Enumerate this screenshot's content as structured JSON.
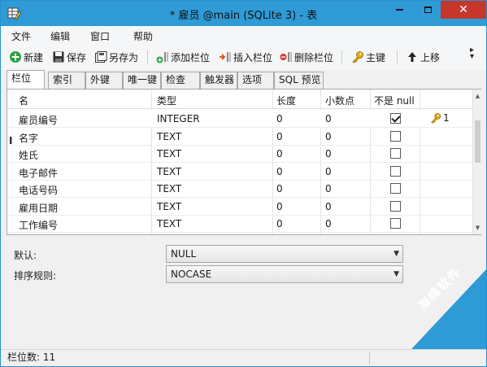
{
  "window": {
    "title": "* 雇员 @main (SQLite 3) - 表"
  },
  "menu": [
    "文件",
    "编辑",
    "窗口",
    "帮助"
  ],
  "toolbar": {
    "new": "新建",
    "save": "保存",
    "save_as": "另存为",
    "add_column": "添加栏位",
    "insert_column": "插入栏位",
    "delete_column": "删除栏位",
    "primary_key": "主键",
    "move_up": "上移"
  },
  "tabs": [
    "栏位",
    "索引",
    "外键",
    "唯一键",
    "检查",
    "触发器",
    "选项",
    "SQL 预览"
  ],
  "grid": {
    "headers": {
      "name": "名",
      "type": "类型",
      "length": "长度",
      "decimals": "小数点",
      "not_null": "不是 null",
      "key": ""
    },
    "rows": [
      {
        "name": "雇员编号",
        "type": "INTEGER",
        "length": "0",
        "decimals": "0",
        "not_null": true,
        "key": "1"
      },
      {
        "name": "名字",
        "type": "TEXT",
        "length": "0",
        "decimals": "0",
        "not_null": false,
        "key": ""
      },
      {
        "name": "姓氏",
        "type": "TEXT",
        "length": "0",
        "decimals": "0",
        "not_null": false,
        "key": ""
      },
      {
        "name": "电子邮件",
        "type": "TEXT",
        "length": "0",
        "decimals": "0",
        "not_null": false,
        "key": ""
      },
      {
        "name": "电话号码",
        "type": "TEXT",
        "length": "0",
        "decimals": "0",
        "not_null": false,
        "key": ""
      },
      {
        "name": "雇用日期",
        "type": "TEXT",
        "length": "0",
        "decimals": "0",
        "not_null": false,
        "key": ""
      },
      {
        "name": "工作编号",
        "type": "TEXT",
        "length": "0",
        "decimals": "0",
        "not_null": false,
        "key": ""
      }
    ],
    "row_indicator": "I"
  },
  "properties": {
    "default_label": "默认:",
    "default_value": "NULL",
    "collation_label": "排序规则:",
    "collation_value": "NOCASE"
  },
  "status": {
    "column_count": "栏位数: 11"
  },
  "watermark": {
    "text": "海绵软件"
  },
  "colors": {
    "accent": "#2f9bd6",
    "close": "#c7362b",
    "key_gold": "#e6a80a"
  }
}
